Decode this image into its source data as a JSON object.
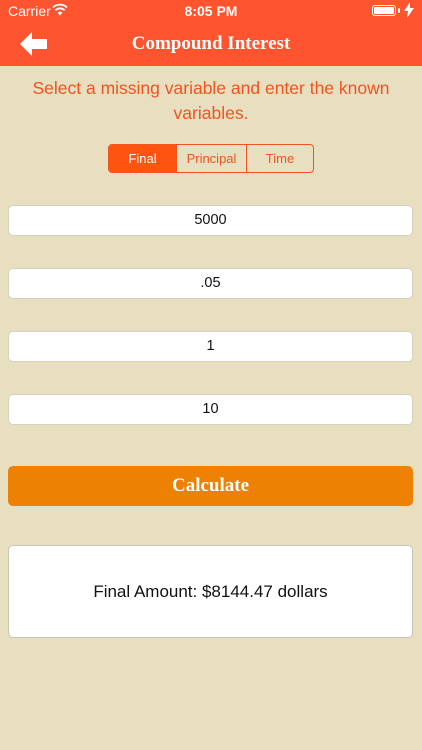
{
  "status_bar": {
    "carrier": "Carrier",
    "time": "8:05 PM",
    "wifi_icon": "wifi-icon",
    "battery_icon": "battery-icon",
    "charging_icon": "charging-bolt-icon"
  },
  "navbar": {
    "title": "Compound Interest",
    "back_icon": "arrow-left-icon"
  },
  "instructions": "Select a missing variable and enter the known variables.",
  "segments": {
    "final": "Final",
    "principal": "Principal",
    "time": "Time",
    "selected": "Final"
  },
  "fields": {
    "field1": "5000",
    "field2": ".05",
    "field3": "1",
    "field4": "10"
  },
  "calculate_label": "Calculate",
  "result": "Final Amount: $8144.47 dollars",
  "colors": {
    "bar": "#ff5430",
    "accent": "#f0541f",
    "button": "#ed8104",
    "background": "#e8dfc1"
  }
}
